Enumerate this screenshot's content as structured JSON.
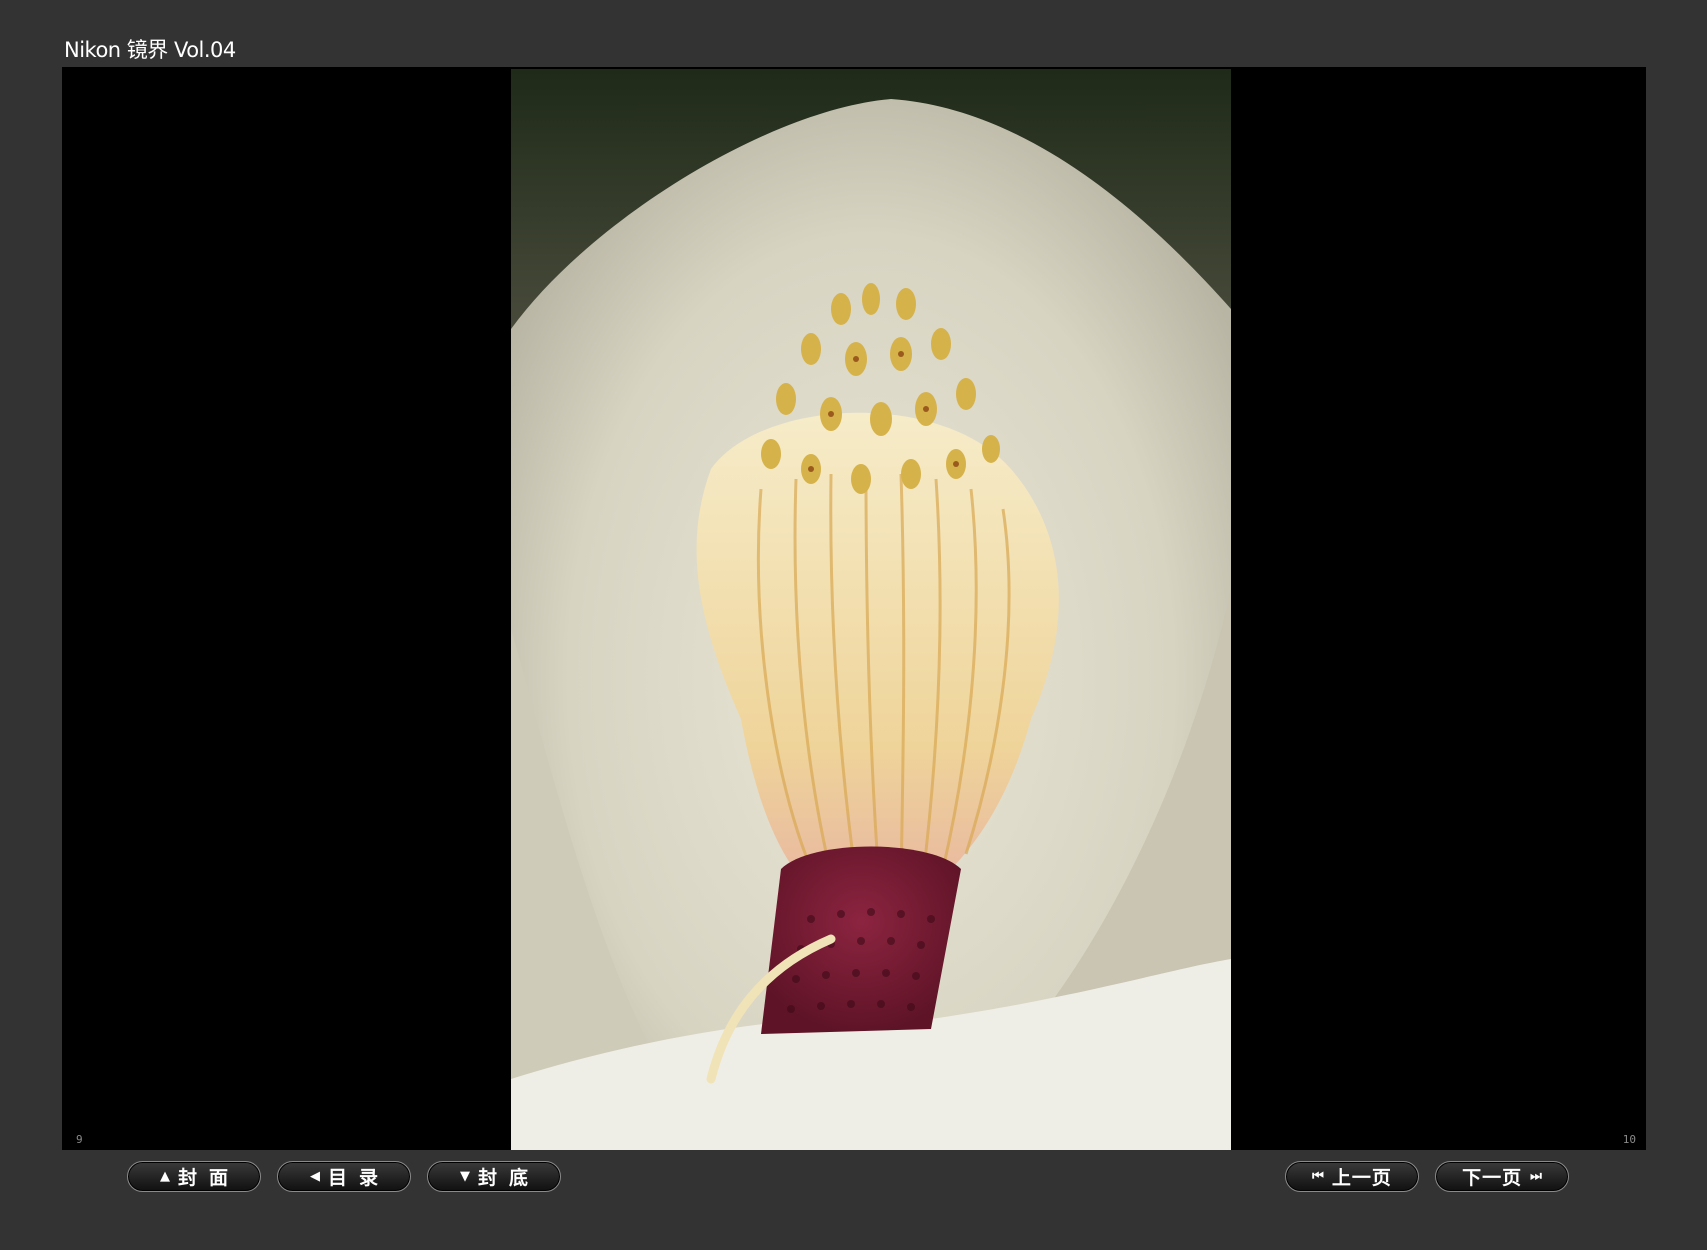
{
  "app": {
    "title": "Nikon 镜界 Vol.04"
  },
  "viewer": {
    "left_page_number": "9",
    "right_page_number": "10",
    "photo_subject": "magnolia flower stamens"
  },
  "toolbar": {
    "cover": {
      "icon": "▲",
      "icon_name": "triangle-up-icon",
      "label": "封面"
    },
    "contents": {
      "icon": "◀",
      "icon_name": "triangle-left-icon",
      "label": "目录"
    },
    "back_cover": {
      "icon": "▼",
      "icon_name": "triangle-down-icon",
      "label": "封底"
    },
    "prev_page": {
      "icon": "⏮",
      "icon_name": "skip-back-icon",
      "label": "上一页"
    },
    "next_page": {
      "icon": "⏭",
      "icon_name": "skip-forward-icon",
      "label": "下一页"
    }
  },
  "colors": {
    "background": "#333333",
    "viewer": "#000000",
    "button_border": "#8a8a8a"
  }
}
